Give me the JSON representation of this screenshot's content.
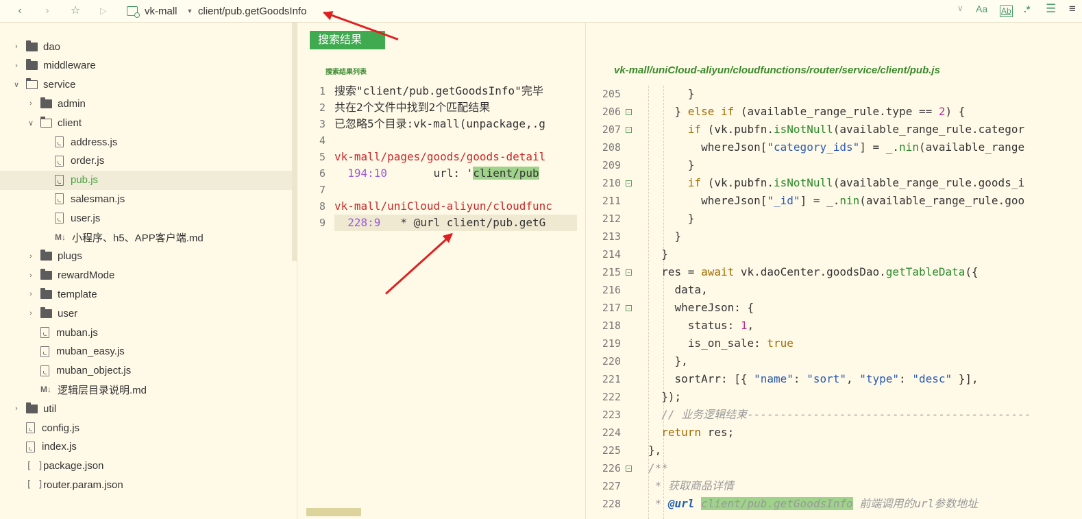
{
  "toolbar": {
    "project_name": "vk-mall",
    "path_value": "client/pub.getGoodsInfo",
    "icons": [
      "back-icon",
      "forward-icon",
      "star-icon",
      "play-icon",
      "project-icon",
      "chevron-down-icon",
      "match-case-icon",
      "whole-word-icon",
      "regex-icon",
      "list-icon"
    ],
    "right_labels": {
      "match_case": "Aa",
      "whole_word": "Ab",
      "regex": ".*"
    }
  },
  "sidebar": {
    "items": [
      {
        "label": "dao",
        "type": "folder",
        "level": 0,
        "expanded": false
      },
      {
        "label": "middleware",
        "type": "folder",
        "level": 0,
        "expanded": false
      },
      {
        "label": "service",
        "type": "folder",
        "level": 0,
        "expanded": true
      },
      {
        "label": "admin",
        "type": "folder",
        "level": 1,
        "expanded": false
      },
      {
        "label": "client",
        "type": "folder",
        "level": 1,
        "expanded": true
      },
      {
        "label": "address.js",
        "type": "file",
        "level": 2
      },
      {
        "label": "order.js",
        "type": "file",
        "level": 2
      },
      {
        "label": "pub.js",
        "type": "file",
        "level": 2,
        "selected": true
      },
      {
        "label": "salesman.js",
        "type": "file",
        "level": 2
      },
      {
        "label": "user.js",
        "type": "file",
        "level": 2
      },
      {
        "label": "小程序、h5、APP客户端.md",
        "type": "md",
        "level": 2
      },
      {
        "label": "plugs",
        "type": "folder",
        "level": 1,
        "expanded": false
      },
      {
        "label": "rewardMode",
        "type": "folder",
        "level": 1,
        "expanded": false
      },
      {
        "label": "template",
        "type": "folder",
        "level": 1,
        "expanded": false
      },
      {
        "label": "user",
        "type": "folder",
        "level": 1,
        "expanded": false
      },
      {
        "label": "muban.js",
        "type": "file",
        "level": 1
      },
      {
        "label": "muban_easy.js",
        "type": "file",
        "level": 1
      },
      {
        "label": "muban_object.js",
        "type": "file",
        "level": 1
      },
      {
        "label": "逻辑层目录说明.md",
        "type": "md",
        "level": 1
      },
      {
        "label": "util",
        "type": "folder",
        "level": 0,
        "expanded": false
      },
      {
        "label": "config.js",
        "type": "file",
        "level": 0
      },
      {
        "label": "index.js",
        "type": "file",
        "level": 0
      },
      {
        "label": "package.json",
        "type": "json",
        "level": 0
      },
      {
        "label": "router.param.json",
        "type": "json",
        "level": 0
      }
    ]
  },
  "search": {
    "tab_label": "搜索结果",
    "subtitle": "搜索结果列表",
    "lines": [
      {
        "n": "1",
        "text": "搜索\"client/pub.getGoodsInfo\"完毕"
      },
      {
        "n": "2",
        "text": "共在2个文件中找到2个匹配结果"
      },
      {
        "n": "3",
        "text": "已忽略5个目录:vk-mall(unpackage,.g"
      },
      {
        "n": "4",
        "text": ""
      },
      {
        "n": "5",
        "text": "vk-mall/pages/goods/goods-detail"
      },
      {
        "n": "6",
        "pos": "194:10",
        "pre": "       url: '",
        "match": "client/pub"
      },
      {
        "n": "7",
        "text": ""
      },
      {
        "n": "8",
        "text": "vk-mall/uniCloud-aliyun/cloudfunc"
      },
      {
        "n": "9",
        "pos": "228:9",
        "pre": "   * @url client/pub.getG"
      }
    ]
  },
  "editor": {
    "file_path": "vk-mall/uniCloud-aliyun/cloudfunctions/router/service/client/pub.js",
    "lines": [
      {
        "n": "205",
        "fold": false
      },
      {
        "n": "206",
        "fold": true
      },
      {
        "n": "207",
        "fold": true
      },
      {
        "n": "208",
        "fold": false
      },
      {
        "n": "209",
        "fold": false
      },
      {
        "n": "210",
        "fold": true
      },
      {
        "n": "211",
        "fold": false
      },
      {
        "n": "212",
        "fold": false
      },
      {
        "n": "213",
        "fold": false
      },
      {
        "n": "214",
        "fold": false
      },
      {
        "n": "215",
        "fold": true
      },
      {
        "n": "216",
        "fold": false
      },
      {
        "n": "217",
        "fold": true
      },
      {
        "n": "218",
        "fold": false
      },
      {
        "n": "219",
        "fold": false
      },
      {
        "n": "220",
        "fold": false
      },
      {
        "n": "221",
        "fold": false
      },
      {
        "n": "222",
        "fold": false
      },
      {
        "n": "223",
        "fold": false
      },
      {
        "n": "224",
        "fold": false
      },
      {
        "n": "225",
        "fold": false
      },
      {
        "n": "226",
        "fold": true
      },
      {
        "n": "227",
        "fold": false
      },
      {
        "n": "228",
        "fold": false
      }
    ],
    "code": {
      "l205": "      }",
      "l206_a": "    } ",
      "l206_kw": "else if",
      "l206_b": " (available_range_rule.type == ",
      "l206_num": "2",
      "l206_c": ") {",
      "l207_kw": "      if",
      "l207_a": " (vk.pubfn.",
      "l207_fn": "isNotNull",
      "l207_b": "(available_range_rule.categor",
      "l208_a": "        whereJson[",
      "l208_str": "\"category_ids\"",
      "l208_b": "] = _.",
      "l208_fn": "nin",
      "l208_c": "(available_range",
      "l209": "      }",
      "l210_kw": "      if",
      "l210_a": " (vk.pubfn.",
      "l210_fn": "isNotNull",
      "l210_b": "(available_range_rule.goods_i",
      "l211_a": "        whereJson[",
      "l211_str": "\"_id\"",
      "l211_b": "] = _.",
      "l211_fn": "nin",
      "l211_c": "(available_range_rule.goo",
      "l212": "      }",
      "l213": "    }",
      "l214": "  }",
      "l215_a": "  res = ",
      "l215_kw": "await",
      "l215_b": " vk.daoCenter.goodsDao.",
      "l215_fn": "getTableData",
      "l215_c": "({",
      "l216": "    data,",
      "l217": "    whereJson: {",
      "l218_a": "      status: ",
      "l218_num": "1",
      "l218_b": ",",
      "l219_a": "      is_on_sale: ",
      "l219_kw": "true",
      "l220": "    },",
      "l221_a": "    sortArr: [{ ",
      "l221_s1": "\"name\"",
      "l221_b": ": ",
      "l221_s2": "\"sort\"",
      "l221_c": ", ",
      "l221_s3": "\"type\"",
      "l221_d": ": ",
      "l221_s4": "\"desc\"",
      "l221_e": " }],",
      "l222": "  });",
      "l223": "  // 业务逻辑结束-------------------------------------------",
      "l224_kw": "  return",
      "l224_a": " res;",
      "l225": "},",
      "l226": "/**",
      "l227": " * 获取商品详情",
      "l228_a": " * ",
      "l228_tag": "@url",
      "l228_b": " ",
      "l228_hl": "client/pub.getGoodsInfo",
      "l228_c": " 前端调用的url参数地址"
    }
  },
  "colors": {
    "background": "#fffae8",
    "accent_green": "#3faa50",
    "arrow_red": "#e02020",
    "match_highlight": "#9fd28a"
  }
}
